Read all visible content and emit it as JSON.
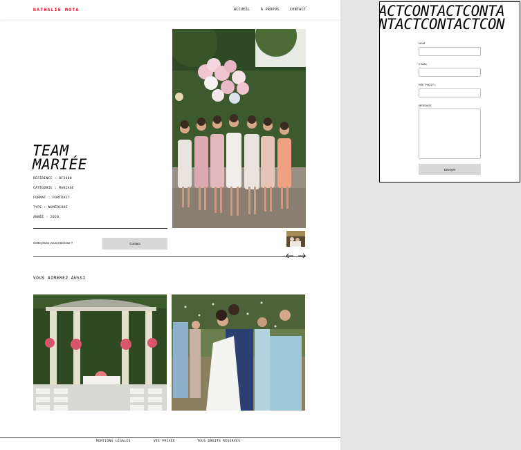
{
  "header": {
    "logo": "NATHALIE MOTA",
    "nav": [
      "ACCUEIL",
      "À PROPOS",
      "CONTACT"
    ]
  },
  "photo": {
    "title_line1": "TEAM",
    "title_line2": "MARIÉE",
    "reference": "RÉFÉRENCE : BF2400",
    "category": "CATÉGORIE : MARIAGE",
    "format": "FORMAT : PORTRAIT",
    "type": "TYPE : NUMÉRIQUE",
    "year": "ANNÉE : 2020"
  },
  "interest": {
    "question": "Cette photo vous intéresse ?",
    "button": "Contact"
  },
  "related": {
    "heading": "VOUS AIMEREZ AUSSI"
  },
  "footer": {
    "links": [
      "MENTIONS LÉGALES",
      "VIE PRIVÉE",
      "TOUS DROITS RÉSERVÉS"
    ]
  },
  "modal": {
    "banner_line1": "ACTCONTACTCONTA",
    "banner_line2": "NTACTCONTACTCON",
    "labels": [
      "NOM",
      "E-MAIL",
      "RÉF. PHOTO",
      "MESSAGE"
    ],
    "submit": "Envoyer"
  },
  "colors": {
    "brand": "#e0001b",
    "button_bg": "#d8d8d8"
  },
  "icons": [
    "arrow-left-icon",
    "arrow-right-icon"
  ]
}
